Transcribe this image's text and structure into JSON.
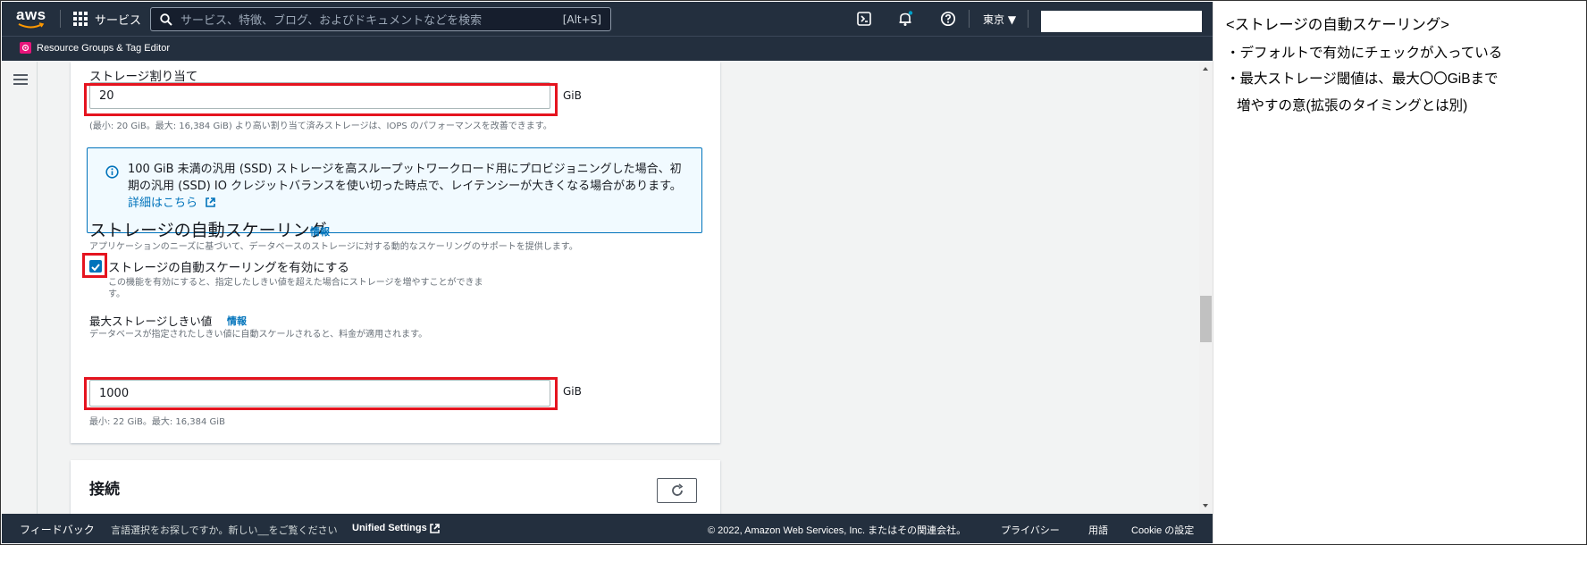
{
  "topbar": {
    "logo_text": "aws",
    "services_label": "サービス",
    "search_placeholder": "サービス、特徴、ブログ、およびドキュメントなどを検索",
    "search_shortcut": "[Alt+S]",
    "region_label": "東京 ▼"
  },
  "subbar": {
    "resource_groups": "Resource Groups & Tag Editor"
  },
  "storage": {
    "alloc_label": "ストレージ割り当て",
    "alloc_value": "20",
    "alloc_unit": "GiB",
    "alloc_desc": "(最小: 20 GiB。最大: 16,384 GiB) より高い割り当て済みストレージは、IOPS のパフォーマンスを改善できます。",
    "info_text": "100 GiB 未満の汎用 (SSD) ストレージを高スループットワークロード用にプロビジョニングした場合、初期の汎用 (SSD) IO クレジットバランスを使い切った時点で、レイテンシーが大きくなる場合があります。",
    "info_link": "詳細はこちら"
  },
  "autoscaling": {
    "title": "ストレージの自動スケーリング",
    "info": "情報",
    "desc": "アプリケーションのニーズに基づいて、データベースのストレージに対する動的なスケーリングのサポートを提供します。",
    "checkbox_label": "ストレージの自動スケーリングを有効にする",
    "checkbox_desc_1": "この機能を有効にすると、指定したしきい値を超えた場合にストレージを増やすことができま",
    "checkbox_desc_2": "す。",
    "checked": true,
    "max_label": "最大ストレージしきい値",
    "max_info": "情報",
    "max_desc": "データベースが指定されたしきい値に自動スケールされると、料金が適用されます。",
    "max_value": "1000",
    "max_unit": "GiB",
    "max_hint": "最小: 22 GiB。最大: 16,384 GiB"
  },
  "connection": {
    "title": "接続"
  },
  "footer": {
    "feedback": "フィードバック",
    "language_notice": "言語選択をお探しですか。新しい__をご覧ください",
    "unified_settings": "Unified Settings",
    "copyright": "© 2022, Amazon Web Services, Inc. またはその関連会社。",
    "privacy": "プライバシー",
    "terms": "用語",
    "cookie": "Cookie の設定"
  },
  "note": {
    "title": "<ストレージの自動スケーリング>",
    "line1": "・デフォルトで有効にチェックが入っている",
    "line2": "・最大ストレージ閾値は、最大〇〇GiBまで",
    "line3": "増やすの意(拡張のタイミングとは別)"
  },
  "colors": {
    "nav_bg": "#232f3e",
    "accent_blue": "#0073bb",
    "highlight_red": "#e5141f",
    "aws_orange": "#ff9900"
  }
}
